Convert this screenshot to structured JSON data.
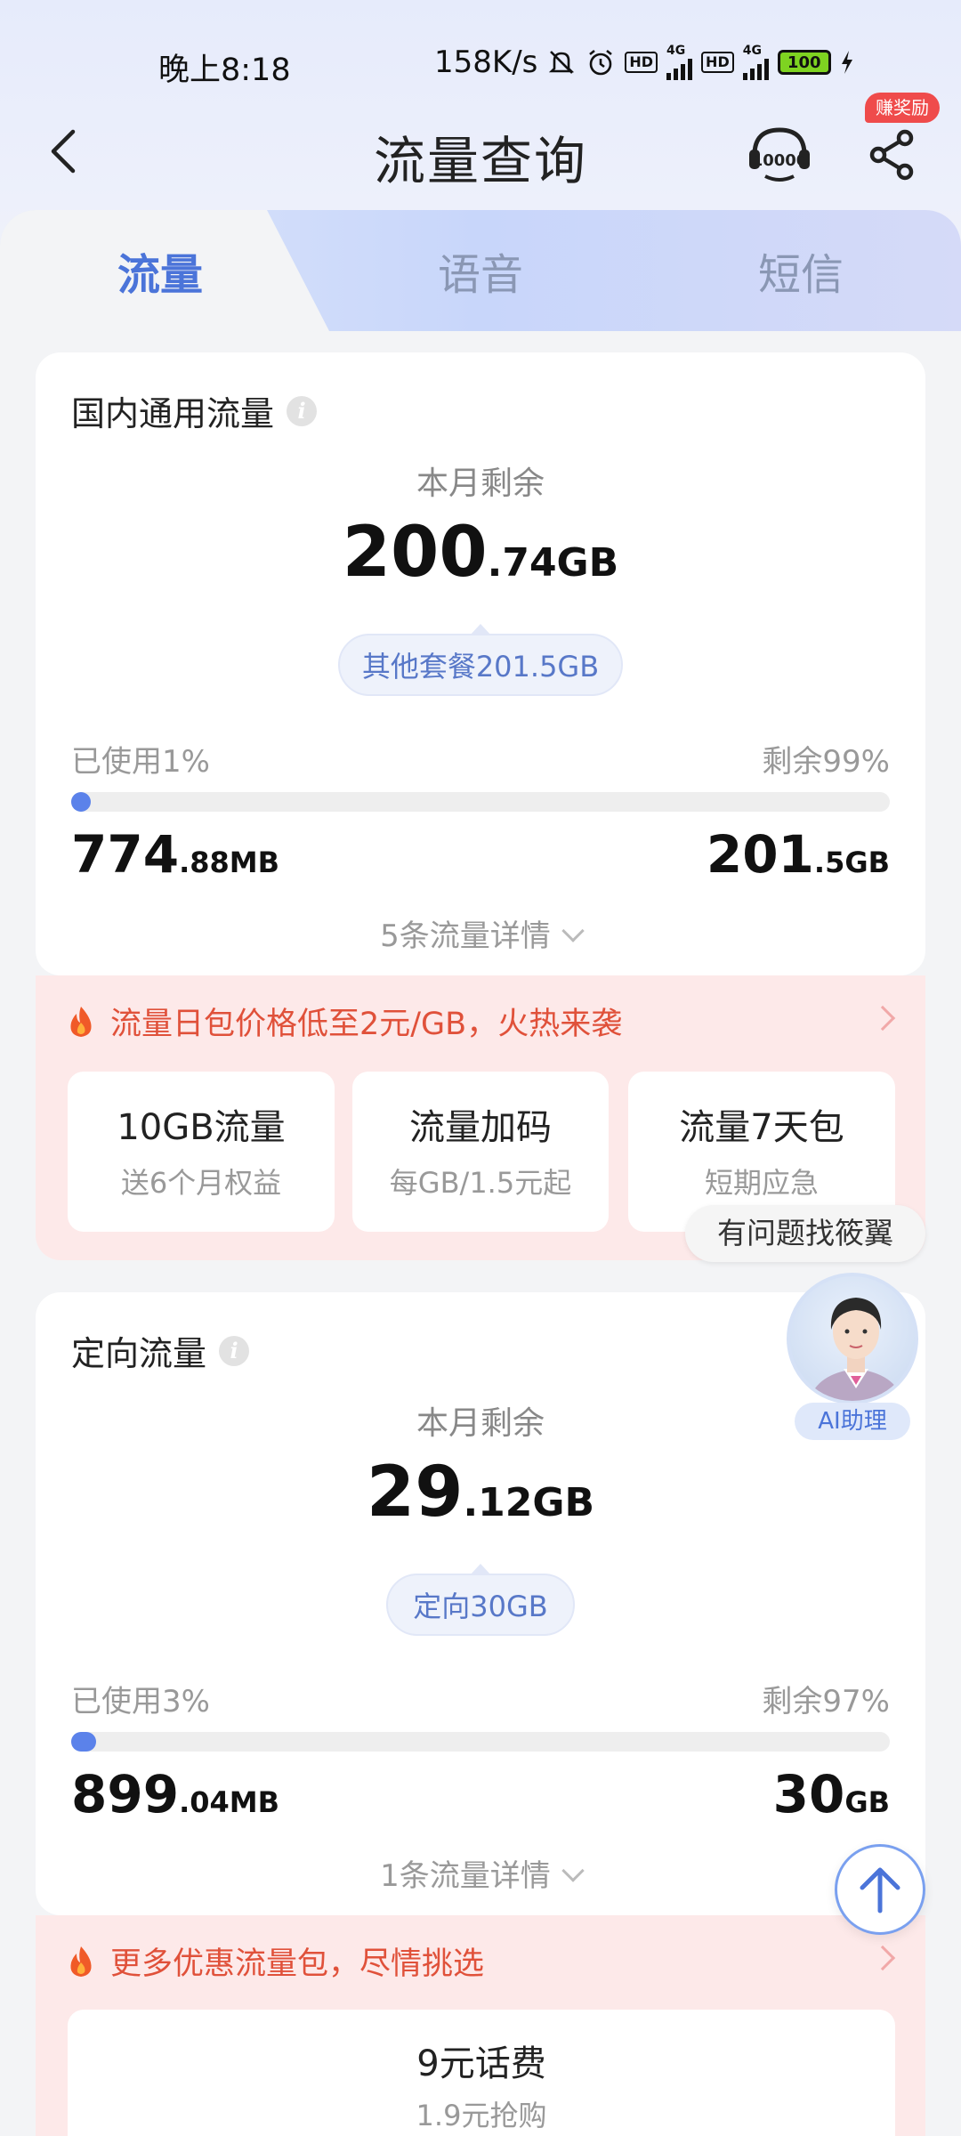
{
  "status_bar": {
    "time": "晚上8:18",
    "speed": "158K/s",
    "hd_badge": "HD",
    "network": "4G",
    "battery": "100"
  },
  "header": {
    "title": "流量查询",
    "service_label": "10000",
    "reward_badge": "赚奖励"
  },
  "tabs": [
    {
      "label": "流量",
      "active": true
    },
    {
      "label": "语音",
      "active": false
    },
    {
      "label": "短信",
      "active": false
    }
  ],
  "domestic": {
    "title": "国内通用流量",
    "remain_label": "本月剩余",
    "remain_int": "200",
    "remain_dec": ".74GB",
    "pill": "其他套餐201.5GB",
    "used_label": "已使用1%",
    "left_label": "剩余99%",
    "used_percent": 1,
    "used_int": "774",
    "used_dec": ".88MB",
    "left_int": "201",
    "left_dec": ".5GB",
    "detail": "5条流量详情"
  },
  "promo1": {
    "headline": "流量日包价格低至2元/GB，火热来袭",
    "items": [
      {
        "title": "10GB流量",
        "subtitle": "送6个月权益"
      },
      {
        "title": "流量加码",
        "subtitle": "每GB/1.5元起"
      },
      {
        "title": "流量7天包",
        "subtitle": "短期应急"
      }
    ]
  },
  "directed": {
    "title": "定向流量",
    "remain_label": "本月剩余",
    "remain_int": "29",
    "remain_dec": ".12GB",
    "pill": "定向30GB",
    "used_label": "已使用3%",
    "left_label": "剩余97%",
    "used_percent": 3,
    "used_int": "899",
    "used_dec": ".04MB",
    "left_int": "30",
    "left_dec": "GB",
    "detail": "1条流量详情"
  },
  "promo2": {
    "headline": "更多优惠流量包，尽情挑选",
    "items": [
      {
        "title": "9元话费",
        "subtitle": "1.9元抢购"
      }
    ]
  },
  "assistant": {
    "bubble": "有问题找筱翼",
    "label": "AI助理"
  },
  "colors": {
    "accent": "#4b74d9",
    "progress": "#5b82ea",
    "promo_text": "#e0513a",
    "promo_bg": "#fde9e9"
  }
}
